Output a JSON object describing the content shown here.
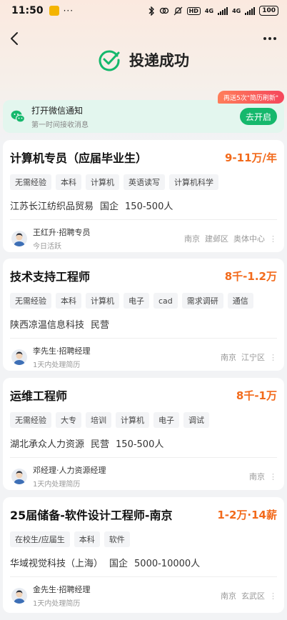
{
  "status_bar": {
    "time": "11:50",
    "dots": "···",
    "hd": "HD",
    "net1": "4G",
    "net2": "4G",
    "battery": "100"
  },
  "header": {
    "title": "投递成功"
  },
  "wechat_notice": {
    "title": "打开微信通知",
    "subtitle": "第一时间接收消息",
    "button": "去开启",
    "promo": "再送5次\"简历刷新\""
  },
  "colors": {
    "accent_green": "#15b86c",
    "salary_orange": "#f26a1b"
  },
  "jobs": [
    {
      "title": "计算机专员（应届毕业生）",
      "salary": "9-11万/年",
      "tags": [
        "无需经验",
        "本科",
        "计算机",
        "英语读写",
        "计算机科学"
      ],
      "company": [
        "江苏长江纺织品贸易",
        "国企",
        "150-500人"
      ],
      "recruiter": "王红升·招聘专员",
      "status": "今日活跃",
      "location": "南京  建邺区  奥体中心"
    },
    {
      "title": "技术支持工程师",
      "salary": "8千-1.2万",
      "tags": [
        "无需经验",
        "本科",
        "计算机",
        "电子",
        "cad",
        "需求调研",
        "通信"
      ],
      "company": [
        "陕西凉温信息科技",
        "民营"
      ],
      "recruiter": "李先生·招聘经理",
      "status": "1天内处理简历",
      "location": "南京  江宁区"
    },
    {
      "title": "运维工程师",
      "salary": "8千-1万",
      "tags": [
        "无需经验",
        "大专",
        "培训",
        "计算机",
        "电子",
        "调试"
      ],
      "company": [
        "湖北承众人力资源",
        "民营",
        "150-500人"
      ],
      "recruiter": "邓经理·人力资源经理",
      "status": "1天内处理简历",
      "location": "南京"
    },
    {
      "title": "25届储备-软件设计工程师-南京",
      "salary": "1-2万·14薪",
      "tags": [
        "在校生/应届生",
        "本科",
        "软件"
      ],
      "company": [
        "华域视觉科技（上海）",
        "国企",
        "5000-10000人"
      ],
      "recruiter": "金先生·招聘经理",
      "status": "1天内处理简历",
      "location": "南京  玄武区"
    }
  ]
}
